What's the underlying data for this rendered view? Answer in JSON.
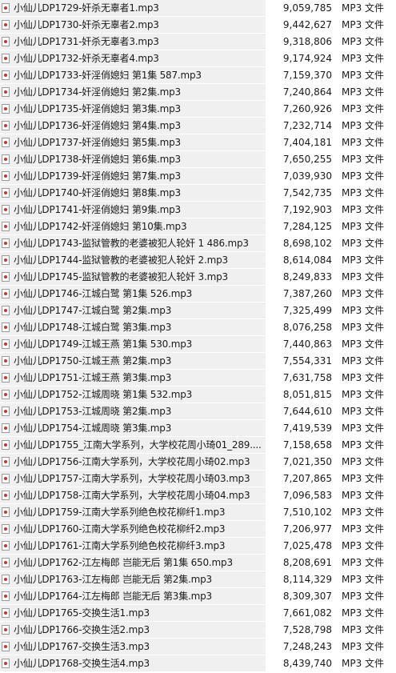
{
  "files": [
    {
      "name": "小仙儿DP1729-奸杀无辜者1.mp3",
      "size": "9,059,785",
      "type": "MP3 文件",
      "icon": "mp3-file-icon"
    },
    {
      "name": "小仙儿DP1730-奸杀无辜者2.mp3",
      "size": "9,442,627",
      "type": "MP3 文件",
      "icon": "mp3-file-icon"
    },
    {
      "name": "小仙儿DP1731-奸杀无辜者3.mp3",
      "size": "9,318,806",
      "type": "MP3 文件",
      "icon": "mp3-file-icon"
    },
    {
      "name": "小仙儿DP1732-奸杀无辜者4.mp3",
      "size": "9,174,924",
      "type": "MP3 文件",
      "icon": "mp3-file-icon"
    },
    {
      "name": "小仙儿DP1733-奸淫俏媳妇 第1集 587.mp3",
      "size": "7,159,370",
      "type": "MP3 文件",
      "icon": "mp3-file-icon"
    },
    {
      "name": "小仙儿DP1734-奸淫俏媳妇 第2集.mp3",
      "size": "7,240,864",
      "type": "MP3 文件",
      "icon": "mp3-file-icon"
    },
    {
      "name": "小仙儿DP1735-奸淫俏媳妇 第3集.mp3",
      "size": "7,260,926",
      "type": "MP3 文件",
      "icon": "mp3-file-icon"
    },
    {
      "name": "小仙儿DP1736-奸淫俏媳妇 第4集.mp3",
      "size": "7,232,714",
      "type": "MP3 文件",
      "icon": "mp3-file-icon"
    },
    {
      "name": "小仙儿DP1737-奸淫俏媳妇 第5集.mp3",
      "size": "7,404,181",
      "type": "MP3 文件",
      "icon": "mp3-file-icon"
    },
    {
      "name": "小仙儿DP1738-奸淫俏媳妇 第6集.mp3",
      "size": "7,650,255",
      "type": "MP3 文件",
      "icon": "mp3-file-icon"
    },
    {
      "name": "小仙儿DP1739-奸淫俏媳妇 第7集.mp3",
      "size": "7,039,930",
      "type": "MP3 文件",
      "icon": "mp3-file-icon"
    },
    {
      "name": "小仙儿DP1740-奸淫俏媳妇 第8集.mp3",
      "size": "7,542,735",
      "type": "MP3 文件",
      "icon": "mp3-file-icon"
    },
    {
      "name": "小仙儿DP1741-奸淫俏媳妇 第9集.mp3",
      "size": "7,192,903",
      "type": "MP3 文件",
      "icon": "mp3-file-icon"
    },
    {
      "name": "小仙儿DP1742-奸淫俏媳妇 第10集.mp3",
      "size": "7,284,125",
      "type": "MP3 文件",
      "icon": "mp3-file-icon"
    },
    {
      "name": "小仙儿DP1743-监狱管教的老婆被犯人轮奸 1 486.mp3",
      "size": "8,698,102",
      "type": "MP3 文件",
      "icon": "mp3-file-icon"
    },
    {
      "name": "小仙儿DP1744-监狱管教的老婆被犯人轮奸 2.mp3",
      "size": "8,614,084",
      "type": "MP3 文件",
      "icon": "mp3-file-icon"
    },
    {
      "name": "小仙儿DP1745-监狱管教的老婆被犯人轮奸 3.mp3",
      "size": "8,249,833",
      "type": "MP3 文件",
      "icon": "mp3-file-icon"
    },
    {
      "name": "小仙儿DP1746-江城白鹭 第1集 526.mp3",
      "size": "7,387,260",
      "type": "MP3 文件",
      "icon": "mp3-file-icon"
    },
    {
      "name": "小仙儿DP1747-江城白鹭 第2集.mp3",
      "size": "7,325,499",
      "type": "MP3 文件",
      "icon": "mp3-file-icon"
    },
    {
      "name": "小仙儿DP1748-江城白鹭 第3集.mp3",
      "size": "8,076,258",
      "type": "MP3 文件",
      "icon": "mp3-file-icon"
    },
    {
      "name": "小仙儿DP1749-江城王燕 第1集 530.mp3",
      "size": "7,440,863",
      "type": "MP3 文件",
      "icon": "mp3-file-icon"
    },
    {
      "name": "小仙儿DP1750-江城王燕 第2集.mp3",
      "size": "7,554,331",
      "type": "MP3 文件",
      "icon": "mp3-file-icon"
    },
    {
      "name": "小仙儿DP1751-江城王燕 第3集.mp3",
      "size": "7,631,758",
      "type": "MP3 文件",
      "icon": "mp3-file-icon"
    },
    {
      "name": "小仙儿DP1752-江城周晓 第1集 532.mp3",
      "size": "8,051,815",
      "type": "MP3 文件",
      "icon": "mp3-file-icon"
    },
    {
      "name": "小仙儿DP1753-江城周晓 第2集.mp3",
      "size": "7,644,610",
      "type": "MP3 文件",
      "icon": "mp3-file-icon"
    },
    {
      "name": "小仙儿DP1754-江城周晓 第3集.mp3",
      "size": "7,419,539",
      "type": "MP3 文件",
      "icon": "mp3-file-icon"
    },
    {
      "name": "小仙儿DP1755_江南大学系列，大学校花周小琦01_289....",
      "size": "7,158,658",
      "type": "MP3 文件",
      "icon": "mp3-file-icon"
    },
    {
      "name": "小仙儿DP1756-江南大学系列，大学校花周小琦02.mp3",
      "size": "7,021,350",
      "type": "MP3 文件",
      "icon": "mp3-file-icon"
    },
    {
      "name": "小仙儿DP1757-江南大学系列，大学校花周小琦03.mp3",
      "size": "7,207,865",
      "type": "MP3 文件",
      "icon": "mp3-file-icon"
    },
    {
      "name": "小仙儿DP1758-江南大学系列，大学校花周小琦04.mp3",
      "size": "7,096,583",
      "type": "MP3 文件",
      "icon": "mp3-file-icon"
    },
    {
      "name": "小仙儿DP1759-江南大学系列绝色校花柳纤1.mp3",
      "size": "7,510,102",
      "type": "MP3 文件",
      "icon": "mp3-file-icon"
    },
    {
      "name": "小仙儿DP1760-江南大学系列绝色校花柳纤2.mp3",
      "size": "7,206,977",
      "type": "MP3 文件",
      "icon": "mp3-file-icon"
    },
    {
      "name": "小仙儿DP1761-江南大学系列绝色校花柳纤3.mp3",
      "size": "7,025,478",
      "type": "MP3 文件",
      "icon": "mp3-file-icon"
    },
    {
      "name": "小仙儿DP1762-江左梅郎 岂能无后 第1集 650.mp3",
      "size": "8,208,691",
      "type": "MP3 文件",
      "icon": "mp3-file-icon"
    },
    {
      "name": "小仙儿DP1763-江左梅郎 岂能无后 第2集.mp3",
      "size": "8,114,329",
      "type": "MP3 文件",
      "icon": "mp3-file-icon"
    },
    {
      "name": "小仙儿DP1764-江左梅郎 岂能无后 第3集.mp3",
      "size": "8,309,307",
      "type": "MP3 文件",
      "icon": "mp3-file-icon"
    },
    {
      "name": "小仙儿DP1765-交换生活1.mp3",
      "size": "7,661,082",
      "type": "MP3 文件",
      "icon": "mp3-file-icon"
    },
    {
      "name": "小仙儿DP1766-交换生活2.mp3",
      "size": "7,528,798",
      "type": "MP3 文件",
      "icon": "mp3-file-icon"
    },
    {
      "name": "小仙儿DP1767-交换生活3.mp3",
      "size": "7,248,243",
      "type": "MP3 文件",
      "icon": "mp3-file-icon"
    },
    {
      "name": "小仙儿DP1768-交换生活4.mp3",
      "size": "8,439,740",
      "type": "MP3 文件",
      "icon": "mp3-file-icon"
    }
  ]
}
